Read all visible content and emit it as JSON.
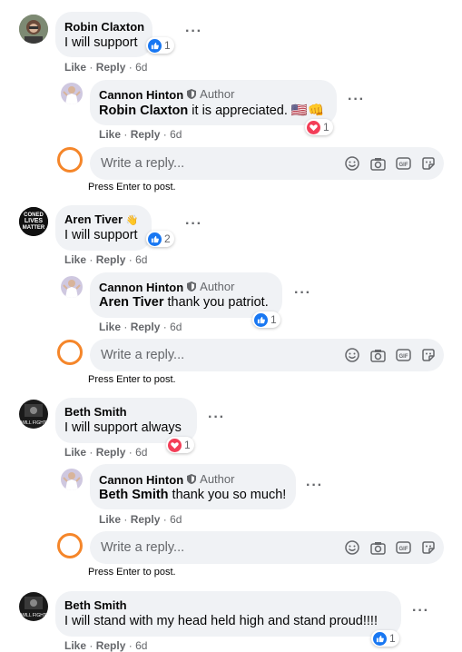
{
  "meta_labels": {
    "like": "Like",
    "reply": "Reply",
    "sep": "·"
  },
  "reply_composer": {
    "placeholder": "Write a reply...",
    "hint": "Press Enter to post."
  },
  "author_badge": "Author",
  "comments": [
    {
      "name": "Robin Claxton",
      "text": "I will support",
      "time": "6d",
      "reaction": {
        "type": "like",
        "count": "1"
      },
      "reply": {
        "name": "Cannon Hinton",
        "mention": "Robin Claxton",
        "text": " it is appreciated. 🇺🇸👊",
        "time": "6d",
        "reaction": {
          "type": "love",
          "count": "1"
        }
      }
    },
    {
      "name": "Aren Tiver",
      "name_emoji": "👋",
      "text": "I will support",
      "time": "6d",
      "reaction": {
        "type": "like",
        "count": "2"
      },
      "reply": {
        "name": "Cannon Hinton",
        "mention": "Aren Tiver",
        "text": " thank you patriot.",
        "time": "6d",
        "reaction": {
          "type": "like",
          "count": "1"
        }
      }
    },
    {
      "name": "Beth Smith",
      "text": "I will support always",
      "time": "6d",
      "reaction": {
        "type": "love",
        "count": "1"
      },
      "reply": {
        "name": "Cannon Hinton",
        "mention": "Beth Smith",
        "text": " thank you so much!",
        "time": "6d"
      }
    },
    {
      "name": "Beth Smith",
      "text": "I will stand with my head held high and stand proud!!!!",
      "time": "6d",
      "reaction": {
        "type": "like",
        "count": "1"
      }
    }
  ],
  "avatar_texts": {
    "blm": [
      "CONED",
      "LIVES",
      "MATTER"
    ],
    "beth": "WILL FIGHT"
  },
  "colors": {
    "like": "#1877f2",
    "love": "#f33e58",
    "ring": "#f5862a",
    "bubble": "#f0f2f5"
  }
}
